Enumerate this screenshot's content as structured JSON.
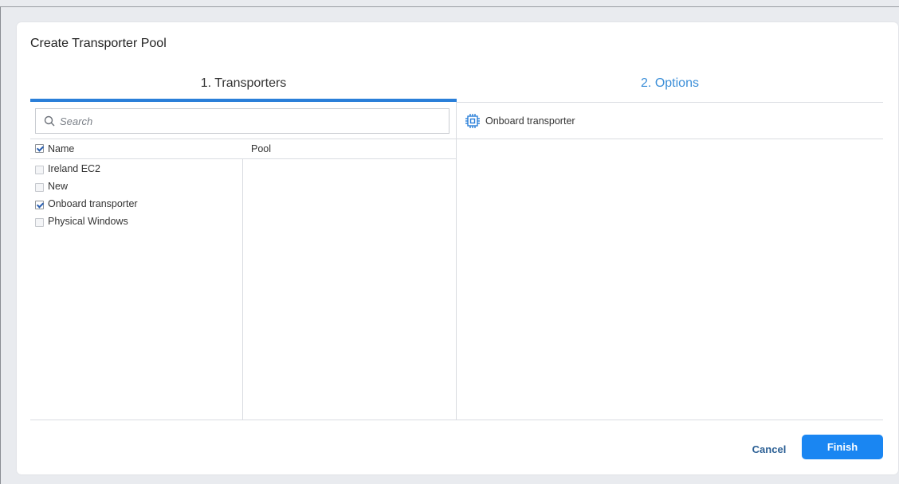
{
  "dialog": {
    "title": "Create Transporter Pool",
    "tabs": [
      {
        "label": "1. Transporters",
        "active": true
      },
      {
        "label": "2. Options",
        "active": false
      }
    ]
  },
  "search": {
    "placeholder": "Search"
  },
  "table": {
    "columns": [
      "Name",
      "Pool"
    ],
    "header_checked": true,
    "rows": [
      {
        "name": "Ireland EC2",
        "checked": false
      },
      {
        "name": "New",
        "checked": false
      },
      {
        "name": "Onboard transporter",
        "checked": true
      },
      {
        "name": "Physical Windows",
        "checked": false
      }
    ]
  },
  "options_panel": {
    "items": [
      {
        "label": "Onboard transporter",
        "icon": "chip-icon"
      }
    ]
  },
  "footer": {
    "cancel_label": "Cancel",
    "finish_label": "Finish"
  },
  "colors": {
    "accent": "#1a86f2",
    "tab_active_underline": "#2a7fd9",
    "tab_inactive_text": "#3b8ed8"
  }
}
